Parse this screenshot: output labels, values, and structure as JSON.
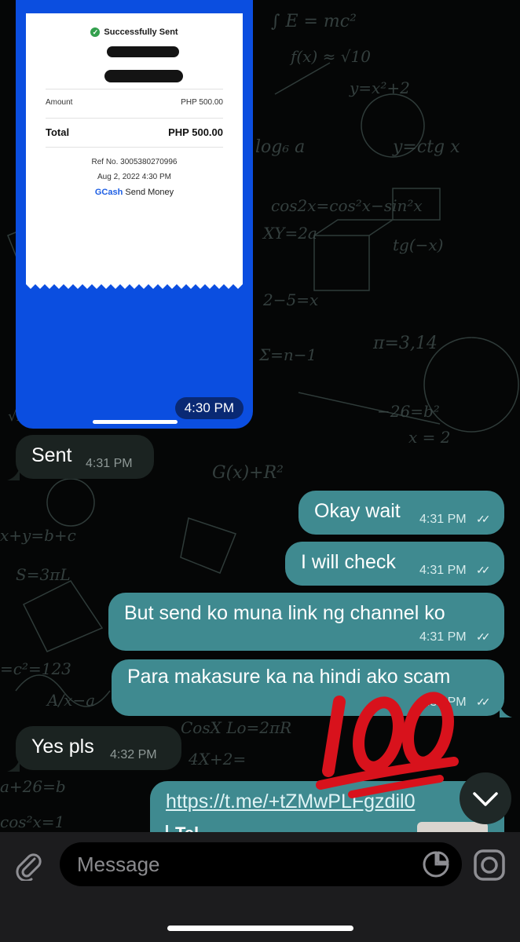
{
  "chat": {
    "image_message": {
      "status": "Successfully Sent",
      "amount_label": "Amount",
      "amount_value": "PHP 500.00",
      "total_label": "Total",
      "total_value": "PHP 500.00",
      "ref": "Ref No. 3005380270996",
      "date": "Aug 2, 2022 4:30 PM",
      "brand_name": "GCash",
      "brand_action": "Send Money",
      "time": "4:30 PM"
    },
    "messages": [
      {
        "dir": "in",
        "text": "Sent",
        "time": "4:31 PM"
      },
      {
        "dir": "out",
        "text": "Okay wait",
        "time": "4:31 PM",
        "read": true
      },
      {
        "dir": "out",
        "text": "I will check",
        "time": "4:31 PM",
        "read": true
      },
      {
        "dir": "out",
        "text": "But send ko muna link ng channel ko",
        "time": "4:31 PM",
        "read": true
      },
      {
        "dir": "out",
        "text": "Para makasure ka na hindi ako scam",
        "time": "4:31 PM",
        "read": true
      },
      {
        "dir": "in",
        "text": "Yes pls",
        "time": "4:32 PM"
      },
      {
        "dir": "out",
        "text": "https://t.me/+tZMwPLFgzdil0",
        "time": ""
      }
    ],
    "link_preview_title": "Tel",
    "overlay_emoji": "hundred-points-icon"
  },
  "composer": {
    "placeholder": "Message"
  },
  "colors": {
    "outgoing_bubble": "#3f8a90",
    "incoming_bubble": "#1b2321",
    "gcash_blue": "#0b4ee0"
  }
}
